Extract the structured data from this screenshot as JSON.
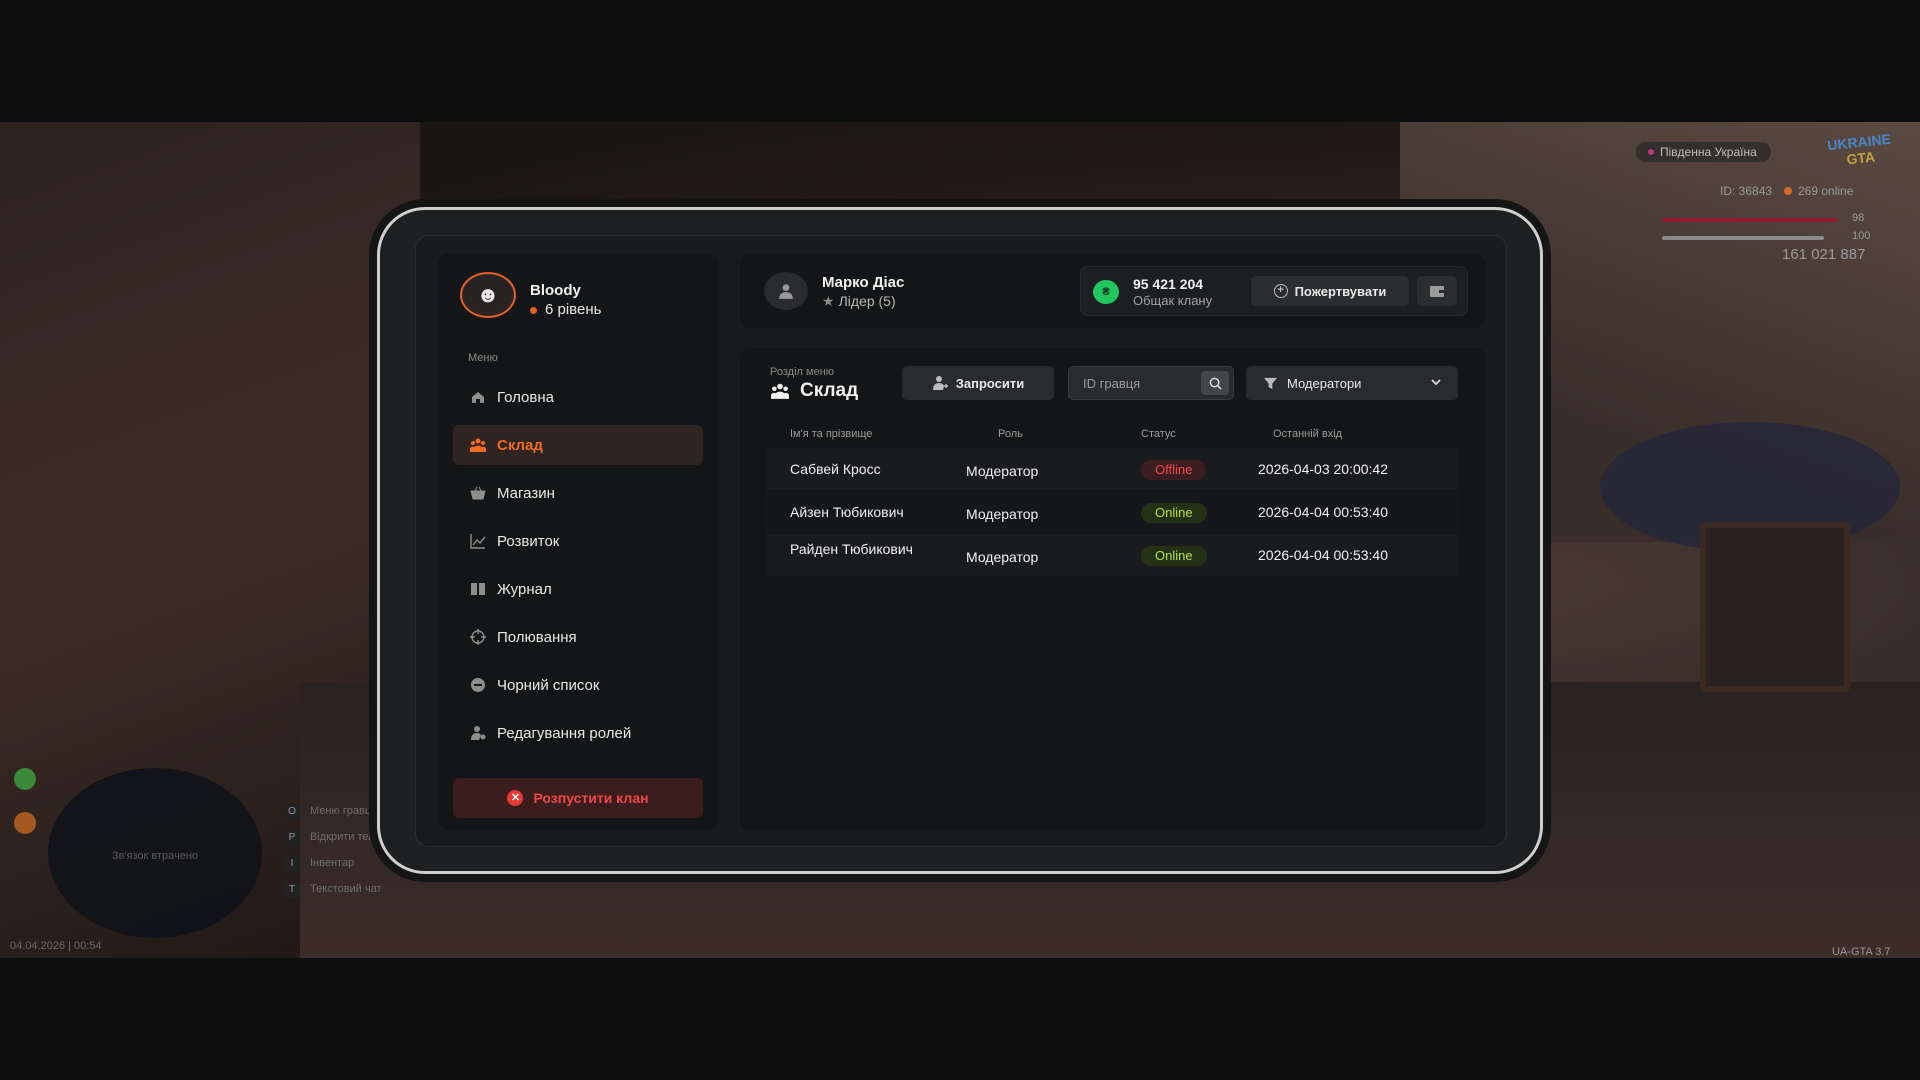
{
  "hud": {
    "region": "Південна Україна",
    "logo_top": "UKRAINE",
    "logo_bottom": "GTA",
    "player_id": "ID: 36843",
    "online": "269 online",
    "health": "98",
    "armor": "100",
    "money": "161 021 887",
    "radar_text": "Зв'язок втрачено",
    "datetime": "04.04.2026 | 00:54",
    "version": "UA-GTA 3.7",
    "hints": [
      {
        "key": "O",
        "label": "Меню гравця"
      },
      {
        "key": "P",
        "label": "Відкрити телефон"
      },
      {
        "key": "I",
        "label": "Інвентар"
      },
      {
        "key": "T",
        "label": "Текстовий чат"
      }
    ]
  },
  "profile": {
    "name": "Bloody",
    "level": "6 рівень"
  },
  "menu": {
    "caption": "Меню",
    "items": [
      {
        "label": "Головна",
        "icon": "home-icon"
      },
      {
        "label": "Склад",
        "icon": "members-icon",
        "active": true
      },
      {
        "label": "Магазин",
        "icon": "shop-icon"
      },
      {
        "label": "Розвиток",
        "icon": "chart-icon"
      },
      {
        "label": "Журнал",
        "icon": "book-icon"
      },
      {
        "label": "Полювання",
        "icon": "crosshair-icon"
      },
      {
        "label": "Чорний список",
        "icon": "block-icon"
      },
      {
        "label": "Редагування ролей",
        "icon": "user-edit-icon"
      }
    ],
    "disband_label": "Розпустити клан"
  },
  "header": {
    "leader_name": "Марко Діас",
    "leader_role": "Лідер (5)",
    "bank_amount": "95 421 204",
    "bank_label": "Общак клану",
    "donate_label": "Пожертвувати"
  },
  "section": {
    "caption": "Розділ меню",
    "title": "Склад",
    "invite_label": "Запросити",
    "search_placeholder": "ID гравця",
    "filter_value": "Модератори"
  },
  "table": {
    "columns": [
      "Ім'я та прізвище",
      "Роль",
      "Статус",
      "Останній вхід"
    ],
    "rows": [
      {
        "name": "Сабвей Кросс",
        "role": "Модератор",
        "status": "Offline",
        "last_login": "2026-04-03 20:00:42"
      },
      {
        "name": "Айзен Тюбикович",
        "role": "Модератор",
        "status": "Online",
        "last_login": "2026-04-04 00:53:40"
      },
      {
        "name": "Райден Тюбикович",
        "role": "Модератор",
        "status": "Online",
        "last_login": "2026-04-04 00:53:40"
      }
    ]
  },
  "colors": {
    "accent": "#f06a24",
    "danger": "#f04848",
    "online": "#b4e04a",
    "bank_coin": "#22c55e"
  }
}
